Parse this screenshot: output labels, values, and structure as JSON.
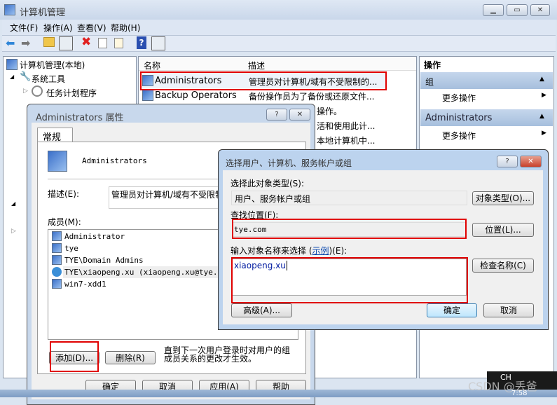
{
  "window": {
    "title": "计算机管理"
  },
  "menu": [
    "文件(F)",
    "操作(A)",
    "查看(V)",
    "帮助(H)"
  ],
  "tree": {
    "root": "计算机管理(本地)",
    "system_tools": "系统工具",
    "task_scheduler": "任务计划程序"
  },
  "list": {
    "columns": [
      "名称",
      "描述"
    ],
    "rows": [
      {
        "name": "Administrators",
        "desc": "管理员对计算机/域有不受限制的..."
      },
      {
        "name": "Backup Operators",
        "desc": "备份操作员为了备份或还原文件..."
      },
      {
        "name": "",
        "desc": "操作。"
      },
      {
        "name": "",
        "desc": "活和使用此计..."
      },
      {
        "name": "",
        "desc": "本地计算机中..."
      }
    ]
  },
  "actions": {
    "header": "操作",
    "sections": [
      {
        "title": "组",
        "item": "更多操作"
      },
      {
        "title": "Administrators",
        "item": "更多操作"
      }
    ]
  },
  "props": {
    "title": "Administrators 属性",
    "tab": "常规",
    "group_name": "Administrators",
    "desc_label": "描述(E):",
    "desc_value": "管理员对计算机/域有不受限制",
    "members_label": "成员(M):",
    "members": [
      "Administrator",
      "tye",
      "TYE\\Domain Admins",
      "TYE\\xiaopeng.xu (xiaopeng.xu@tye.com)",
      "win7-xdd1"
    ],
    "add": "添加(D)...",
    "remove": "删除(R)",
    "note1": "直到下一次用户登录时对用户的组",
    "note2": "成员关系的更改才生效。",
    "ok": "确定",
    "cancel": "取消",
    "apply": "应用(A)",
    "help": "帮助"
  },
  "select": {
    "title": "选择用户、计算机、服务帐户或组",
    "type_label": "选择此对象类型(S):",
    "type_value": "用户、服务帐户或组",
    "type_btn": "对象类型(O)...",
    "loc_label": "查找位置(F):",
    "loc_value": "tye.com",
    "loc_btn": "位置(L)...",
    "name_label_pre": "输入对象名称来选择 (",
    "name_label_link": "示例",
    "name_label_post": ")(E):",
    "name_value": "xiaopeng.xu",
    "check_btn": "检查名称(C)",
    "advanced": "高级(A)...",
    "ok": "确定",
    "cancel": "取消"
  },
  "taskbar": {
    "lang": "CH",
    "time": "7:58"
  },
  "watermark": "CSDN @丢爸"
}
